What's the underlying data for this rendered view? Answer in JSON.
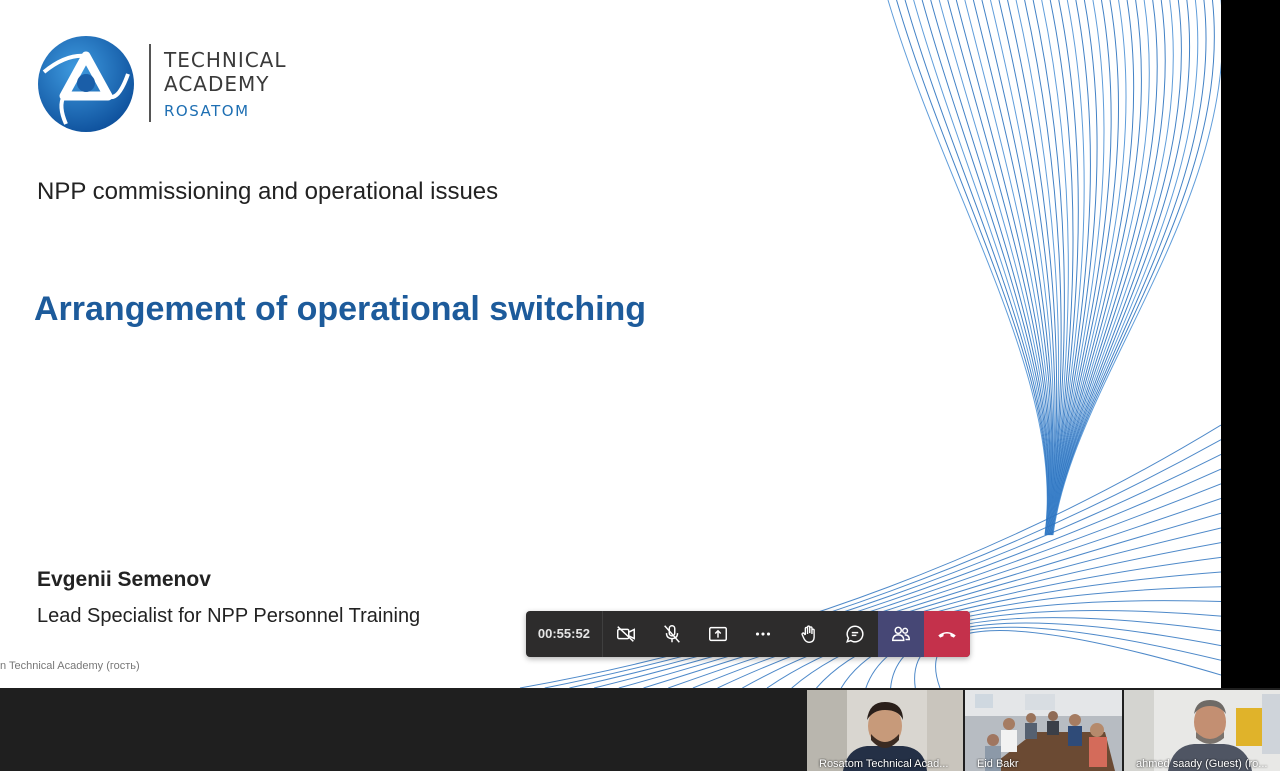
{
  "slide": {
    "logo": {
      "line1": "TECHNICAL",
      "line2": "ACADEMY",
      "line3": "ROSATOM"
    },
    "subtitle": "NPP commissioning and operational issues",
    "title": "Arrangement of operational switching",
    "speaker_name": "Evgenii Semenov",
    "speaker_role": "Lead Specialist for NPP Personnel Training",
    "presenter_label": "n Technical Academy (гость)"
  },
  "toolbar": {
    "timer": "00:55:52",
    "icons": [
      "camera-off-icon",
      "mic-off-icon",
      "share-screen-icon",
      "more-options-icon",
      "raise-hand-icon",
      "chat-icon",
      "participants-icon",
      "hang-up-icon"
    ],
    "colors": {
      "background": "#2d2c2c",
      "participants_active": "#464775",
      "hangup": "#c4314b"
    }
  },
  "participants": [
    {
      "name": "Rosatom Technical Acad..."
    },
    {
      "name": "Eid Bakr"
    },
    {
      "name": "ahmed saady (Guest) (ro..."
    }
  ],
  "colors": {
    "title": "#1d5b9b",
    "brand_blue": "#1e6fb3"
  }
}
